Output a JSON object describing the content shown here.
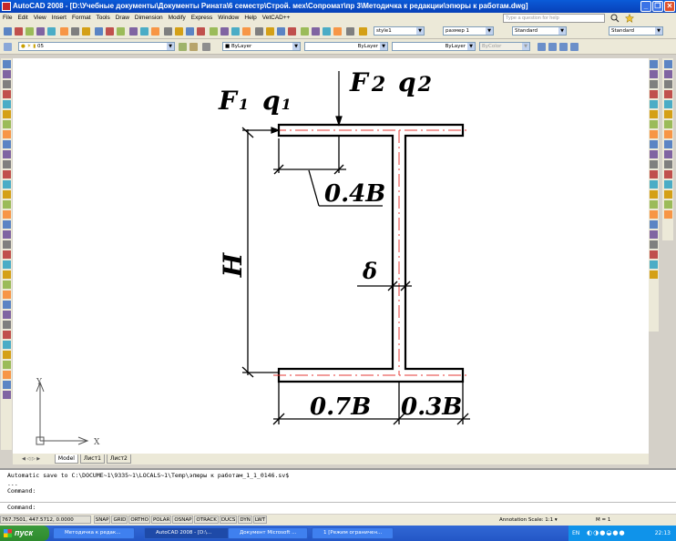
{
  "window": {
    "title": "AutoCAD 2008 - [D:\\Учебные документы\\Документы Рината\\6 семестр\\Строй. мех\\Сопромат\\пр 3\\Методичка к редакции\\эпюры к работам.dwg]",
    "minimize": "_",
    "restore": "❐",
    "close": "✕"
  },
  "menu": {
    "items": [
      "File",
      "Edit",
      "View",
      "Insert",
      "Format",
      "Tools",
      "Draw",
      "Dimension",
      "Modify",
      "Express",
      "Window",
      "Help",
      "VetCAD++"
    ],
    "search_placeholder": "Type a question for help"
  },
  "toolbar": {
    "text_style": "style1",
    "dim_style": "размер 1",
    "table_style": "Standard",
    "multileader_style": "Standard",
    "layer": "05",
    "color": "ByLayer",
    "linetype": "ByLayer",
    "lineweight": "ByLayer",
    "plotstyle": "ByColor"
  },
  "drawing": {
    "labels": {
      "F1": "F",
      "F1_sub": "1",
      "q1": "q",
      "q1_sub": "1",
      "F2": "F",
      "F2_sub": "2",
      "q2": "q",
      "q2_sub": "2",
      "H": "H",
      "delta": "δ",
      "dim_top": "0.4B",
      "dim_bottom_left": "0.7B",
      "dim_bottom_right": "0.3B"
    },
    "ucs": {
      "x_label": "X",
      "y_label": "Y"
    }
  },
  "tabs": {
    "model": "Model",
    "layout1": "Лист1",
    "layout2": "Лист2"
  },
  "command": {
    "line1": "Automatic save to C:\\DOCUME~1\\9335~1\\LOCALS~1\\Temp\\эпюры к работам_1_1_0146.sv$",
    "line2": "...",
    "line3": "Command:",
    "prompt": "Command:"
  },
  "status": {
    "coords": "767.7501, 447.5712, 0.0000",
    "buttons": [
      "SNAP",
      "GRID",
      "ORTHO",
      "POLAR",
      "OSNAP",
      "OTRACK",
      "DUCS",
      "DYN",
      "LWT"
    ],
    "annotation_scale": "Annotation Scale: 1:1 ▾",
    "scale_ratio": "M = 1"
  },
  "taskbar": {
    "start": "пуск",
    "tasks": [
      "Методичка к редак...",
      "AutoCAD 2008 - [D:\\...",
      "Документ Microsoft ...",
      "1 [Режим ограничен..."
    ],
    "lang": "EN",
    "clock": "22:13"
  },
  "colors": {
    "titlebar": "#0a5bd8",
    "centerline": "#e53935",
    "taskbar": "#2356c6",
    "start": "#3c9a3c"
  }
}
